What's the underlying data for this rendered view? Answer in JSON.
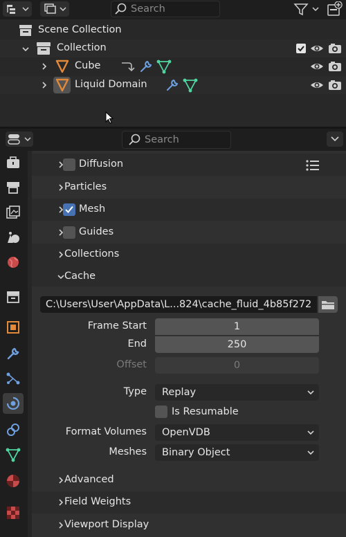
{
  "outliner": {
    "search_placeholder": "Search",
    "scene_collection": "Scene Collection",
    "collection": "Collection",
    "items": [
      {
        "label": "Cube"
      },
      {
        "label": "Liquid Domain"
      }
    ]
  },
  "properties": {
    "search_placeholder": "Search",
    "panels": {
      "diffusion": "Diffusion",
      "particles": "Particles",
      "mesh": "Mesh",
      "guides": "Guides",
      "collections": "Collections",
      "cache": "Cache",
      "advanced": "Advanced",
      "field_weights": "Field Weights",
      "viewport_display": "Viewport Display"
    },
    "cache": {
      "directory": "C:\\Users\\User\\AppData\\L...824\\cache_fluid_4b85f272",
      "frame_start_label": "Frame Start",
      "frame_start": "1",
      "end_label": "End",
      "end": "250",
      "offset_label": "Offset",
      "offset": "0",
      "type_label": "Type",
      "type_value": "Replay",
      "is_resumable_label": "Is Resumable",
      "format_volumes_label": "Format Volumes",
      "format_volumes_value": "OpenVDB",
      "meshes_label": "Meshes",
      "meshes_value": "Binary Object"
    }
  },
  "colors": {
    "accent_blue": "#4772b3",
    "mesh_orange": "#e38a3a",
    "modifier_blue": "#6fa0e0",
    "data_green": "#4fd6a0"
  }
}
